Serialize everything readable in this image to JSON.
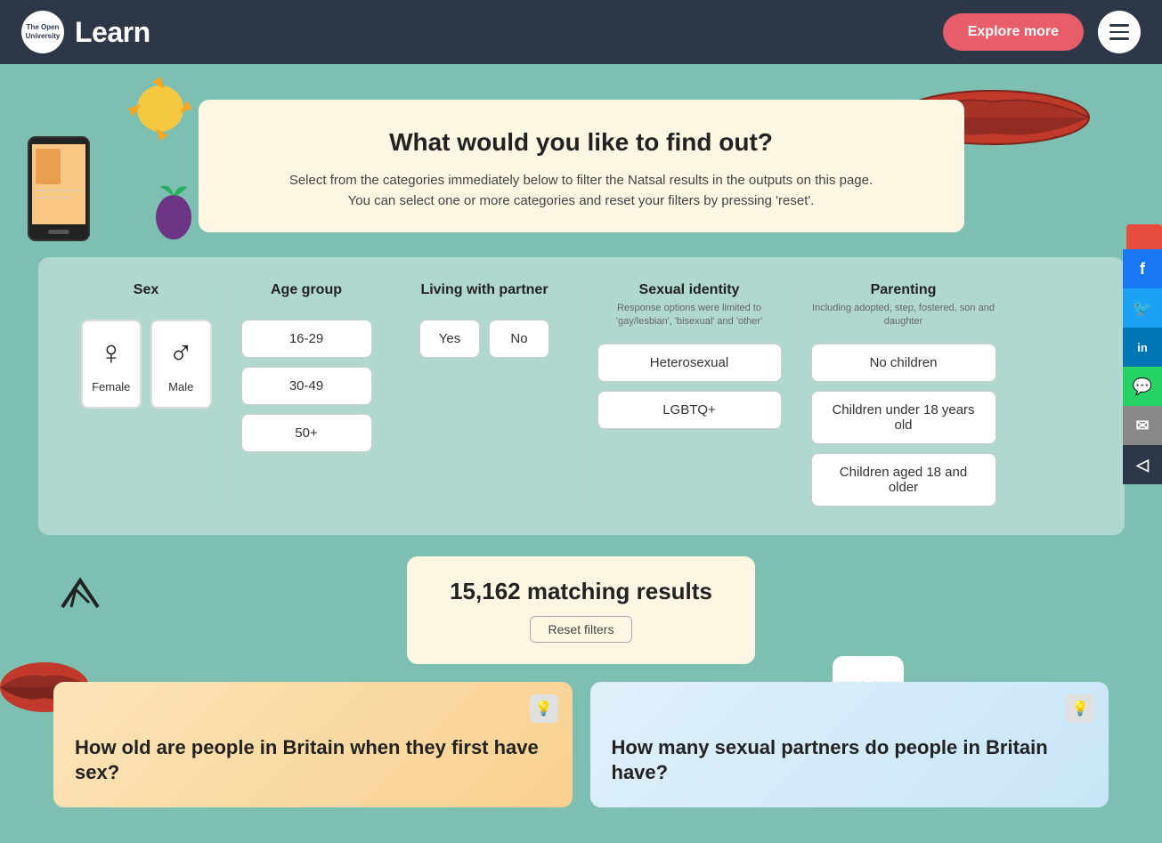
{
  "header": {
    "logo_text_regular": "The Open University",
    "logo_text_brand_regular": "Open",
    "logo_text_brand_bold": "Learn",
    "explore_btn": "Explore more",
    "menu_aria": "Menu"
  },
  "filter_card": {
    "title": "What would you like to find out?",
    "description_line1": "Select from the categories immediately below to filter the Natsal results in the outputs on this page.",
    "description_line2": "You can select one or more categories and reset your filters by pressing 'reset'."
  },
  "filter_panel": {
    "sex": {
      "title": "Sex",
      "options": [
        {
          "label": "Female",
          "symbol": "♀"
        },
        {
          "label": "Male",
          "symbol": "♂"
        }
      ]
    },
    "age_group": {
      "title": "Age group",
      "options": [
        "16-29",
        "30-49",
        "50+"
      ]
    },
    "living_with_partner": {
      "title": "Living with partner",
      "options": [
        "Yes",
        "No"
      ]
    },
    "sexual_identity": {
      "title": "Sexual identity",
      "subtitle": "Response options were limited to 'gay/lesbian', 'bisexual' and 'other'",
      "options": [
        "Heterosexual",
        "LGBTQ+"
      ]
    },
    "parenting": {
      "title": "Parenting",
      "subtitle": "Including adopted, step, fostered, son and daughter",
      "options": [
        "No children",
        "Children under 18 years old",
        "Children aged 18 and older"
      ]
    }
  },
  "results": {
    "count": "15,162 matching results",
    "reset_btn": "Reset filters"
  },
  "articles": [
    {
      "title": "How old are people in Britain when they first have sex?",
      "icon": "💡"
    },
    {
      "title": "How many sexual partners do people in Britain have?",
      "icon": "💡"
    }
  ],
  "social": {
    "buttons": [
      {
        "label": "f",
        "name": "facebook"
      },
      {
        "label": "t",
        "name": "twitter"
      },
      {
        "label": "in",
        "name": "linkedin"
      },
      {
        "label": "w",
        "name": "whatsapp"
      },
      {
        "label": "@",
        "name": "email"
      },
      {
        "label": "◁",
        "name": "share"
      }
    ]
  }
}
